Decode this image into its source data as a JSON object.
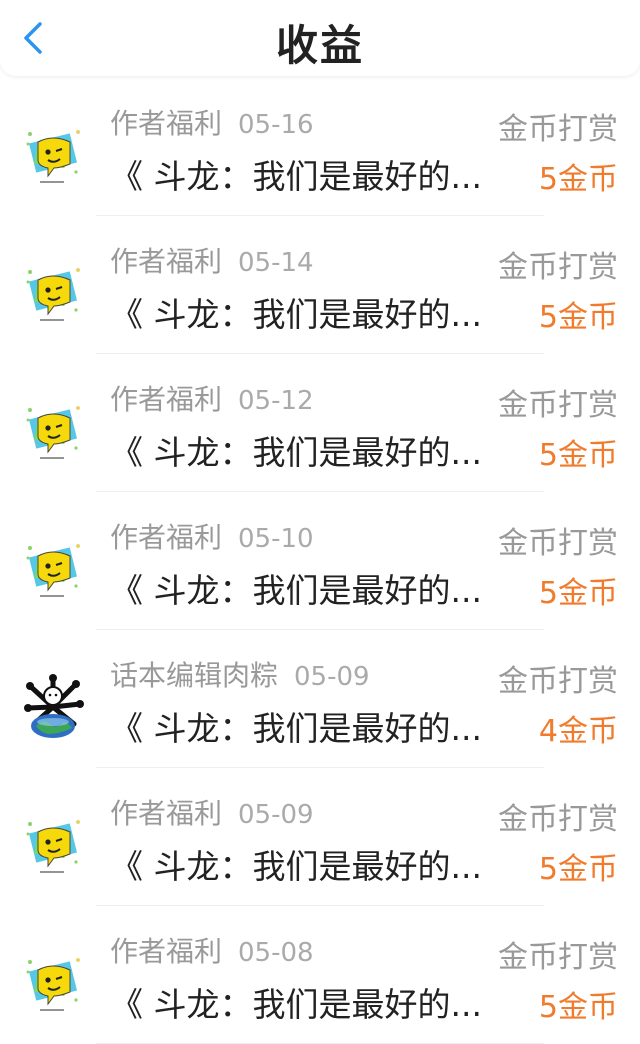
{
  "header": {
    "back_icon": "chevron-left-icon",
    "title": "收益",
    "accent_color": "#2a94f0"
  },
  "colors": {
    "amount": "#f07b2c",
    "muted": "#999999"
  },
  "rows": [
    {
      "source": "作者福利",
      "date": "05-16",
      "book": "《 斗龙：我们是最好的...",
      "type": "金币打赏",
      "amount": "5金币",
      "avatar": "emoji"
    },
    {
      "source": "作者福利",
      "date": "05-14",
      "book": "《 斗龙：我们是最好的...",
      "type": "金币打赏",
      "amount": "5金币",
      "avatar": "emoji"
    },
    {
      "source": "作者福利",
      "date": "05-12",
      "book": "《 斗龙：我们是最好的...",
      "type": "金币打赏",
      "amount": "5金币",
      "avatar": "emoji"
    },
    {
      "source": "作者福利",
      "date": "05-10",
      "book": "《 斗龙：我们是最好的...",
      "type": "金币打赏",
      "amount": "5金币",
      "avatar": "emoji"
    },
    {
      "source": "话本编辑肉粽",
      "date": "05-09",
      "book": "《 斗龙：我们是最好的...",
      "type": "金币打赏",
      "amount": "4金币",
      "avatar": "earth"
    },
    {
      "source": "作者福利",
      "date": "05-09",
      "book": "《 斗龙：我们是最好的...",
      "type": "金币打赏",
      "amount": "5金币",
      "avatar": "emoji"
    },
    {
      "source": "作者福利",
      "date": "05-08",
      "book": "《 斗龙：我们是最好的...",
      "type": "金币打赏",
      "amount": "5金币",
      "avatar": "emoji"
    }
  ]
}
